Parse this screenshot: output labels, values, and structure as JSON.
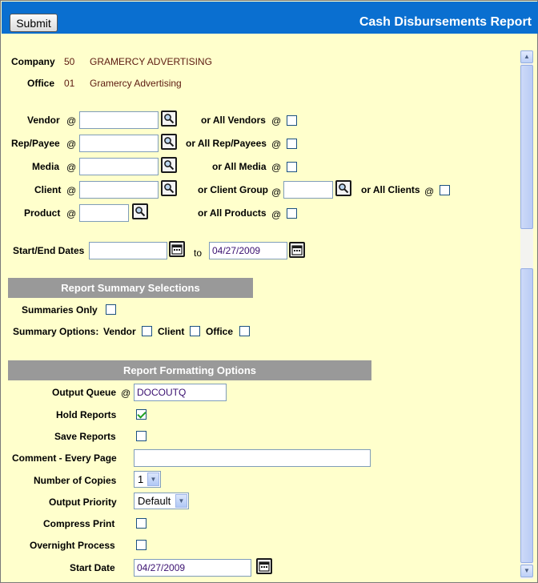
{
  "header": {
    "submit_label": "Submit",
    "title": "Cash Disbursements Report"
  },
  "company": {
    "label": "Company",
    "code": "50",
    "name": "GRAMERCY ADVERTISING"
  },
  "office": {
    "label": "Office",
    "code": "01",
    "name": "Gramercy Advertising"
  },
  "criteria": {
    "at": "@",
    "vendor": {
      "label": "Vendor",
      "all_label": "or All Vendors",
      "value": ""
    },
    "rep_payee": {
      "label": "Rep/Payee",
      "all_label": "or All Rep/Payees",
      "value": ""
    },
    "media": {
      "label": "Media",
      "all_label": "or All Media",
      "value": ""
    },
    "client": {
      "label": "Client",
      "group_label": "or Client Group",
      "all_label": "or All Clients",
      "value": "",
      "group_value": ""
    },
    "product": {
      "label": "Product",
      "all_label": "or All Products",
      "value": ""
    }
  },
  "dates": {
    "label": "Start/End Dates",
    "start": "",
    "to_label": "to",
    "end": "04/27/2009"
  },
  "summary": {
    "section_title": "Report Summary Selections",
    "summaries_only_label": "Summaries Only",
    "options_label": "Summary Options:",
    "vendor_label": "Vendor",
    "client_label": "Client",
    "office_label": "Office"
  },
  "formatting": {
    "section_title": "Report Formatting Options",
    "output_queue_label": "Output Queue",
    "output_queue_at": "@",
    "output_queue_value": "DOCOUTQ",
    "hold_reports_label": "Hold Reports",
    "hold_reports_checked": true,
    "save_reports_label": "Save Reports",
    "comment_label": "Comment - Every Page",
    "comment_value": "",
    "copies_label": "Number of Copies",
    "copies_value": "1",
    "priority_label": "Output Priority",
    "priority_value": "Default",
    "compress_label": "Compress Print",
    "overnight_label": "Overnight Process",
    "start_date_label": "Start Date",
    "start_date_value": "04/27/2009"
  },
  "icons": {
    "lookup": "magnifier-icon",
    "calendar": "calendar-icon"
  },
  "colors": {
    "titlebar": "#0a6fd0",
    "background": "#ffffcc",
    "section_bar": "#999999"
  }
}
